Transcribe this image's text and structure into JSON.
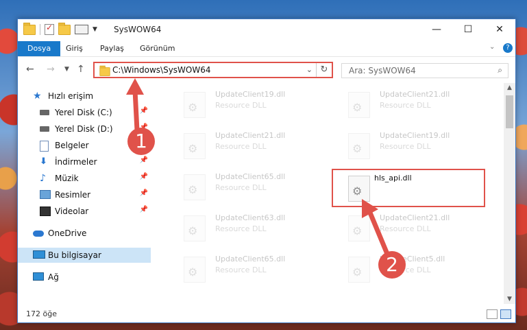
{
  "window": {
    "title": "SysWOW64",
    "controls": {
      "minimize": "—",
      "maximize": "☐",
      "close": "✕"
    }
  },
  "ribbon": {
    "tabs": [
      {
        "label": "Dosya",
        "active": true
      },
      {
        "label": "Giriş",
        "active": false
      },
      {
        "label": "Paylaş",
        "active": false
      },
      {
        "label": "Görünüm",
        "active": false
      }
    ]
  },
  "address": {
    "path": "C:\\Windows\\SysWOW64",
    "search_placeholder": "Ara: SysWOW64"
  },
  "nav": {
    "items": [
      {
        "label": "Hızlı erişim",
        "icon": "star-icon",
        "pinned": false
      },
      {
        "label": "Yerel Disk (C:)",
        "icon": "drive-icon",
        "pinned": true
      },
      {
        "label": "Yerel Disk (D:)",
        "icon": "drive-icon",
        "pinned": true
      },
      {
        "label": "Belgeler",
        "icon": "document-icon",
        "pinned": true
      },
      {
        "label": "İndirmeler",
        "icon": "download-icon",
        "pinned": true
      },
      {
        "label": "Müzik",
        "icon": "music-icon",
        "pinned": true
      },
      {
        "label": "Resimler",
        "icon": "pictures-icon",
        "pinned": true
      },
      {
        "label": "Videolar",
        "icon": "video-icon",
        "pinned": true
      },
      {
        "label": "OneDrive",
        "icon": "cloud-icon",
        "pinned": false
      },
      {
        "label": "Bu bilgisayar",
        "icon": "computer-icon",
        "pinned": false,
        "selected": true
      },
      {
        "label": "Ağ",
        "icon": "network-icon",
        "pinned": false
      }
    ]
  },
  "files": [
    {
      "name": "UpdateClient19.dll",
      "type": "Resource DLL"
    },
    {
      "name": "UpdateClient21.dll",
      "type": "Resource DLL"
    },
    {
      "name": "UpdateClient21.dll",
      "type": "Resource DLL"
    },
    {
      "name": "UpdateClient19.dll",
      "type": "Resource DLL"
    },
    {
      "name": "UpdateClient65.dll",
      "type": "Resource DLL"
    },
    {
      "name": "hls_api.dll",
      "type": ""
    },
    {
      "name": "UpdateClient63.dll",
      "type": "Resource DLL"
    },
    {
      "name": "UpdateClient21.dll",
      "type": "Resource DLL"
    },
    {
      "name": "UpdateClient65.dll",
      "type": "Resource DLL"
    },
    {
      "name": "UpdateClient5.dll",
      "type": "Resource DLL"
    }
  ],
  "status": {
    "count": "172 öğe"
  },
  "annotations": {
    "step1": "1",
    "step2": "2",
    "accent": "#e0524a"
  }
}
